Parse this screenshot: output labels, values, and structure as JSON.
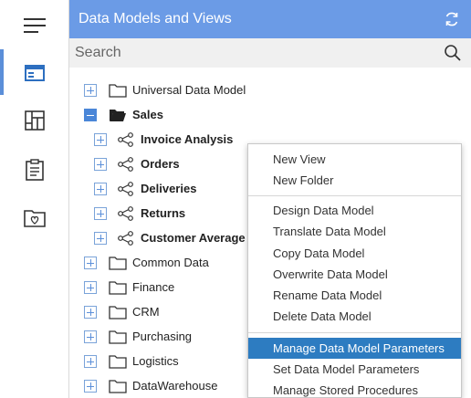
{
  "panel": {
    "title": "Data Models and Views",
    "search_placeholder": "Search"
  },
  "rail": {
    "items": [
      {
        "icon": "hamburger-menu-icon"
      },
      {
        "icon": "data-models-icon",
        "active": true
      },
      {
        "icon": "dashboard-layout-icon"
      },
      {
        "icon": "clipboard-report-icon"
      },
      {
        "icon": "favorites-folder-icon"
      }
    ]
  },
  "tree": {
    "universal": "Universal Data Model",
    "sales": "Sales",
    "sales_children": [
      "Invoice Analysis",
      "Orders",
      "Deliveries",
      "Returns",
      "Customer Average R"
    ],
    "folders": [
      "Common Data",
      "Finance",
      "CRM",
      "Purchasing",
      "Logistics",
      "DataWarehouse"
    ]
  },
  "context_menu": {
    "new_view": "New View",
    "new_folder": "New Folder",
    "design": "Design Data Model",
    "translate": "Translate Data Model",
    "copy": "Copy Data Model",
    "overwrite": "Overwrite Data Model",
    "rename": "Rename Data Model",
    "delete": "Delete Data Model",
    "manage_params": "Manage Data Model Parameters",
    "set_params": "Set Data Model Parameters",
    "manage_procs": "Manage Stored Procedures"
  },
  "colors": {
    "header": "#6b9be6",
    "highlight": "#2d7cc1",
    "accent": "#5b8fd9"
  }
}
